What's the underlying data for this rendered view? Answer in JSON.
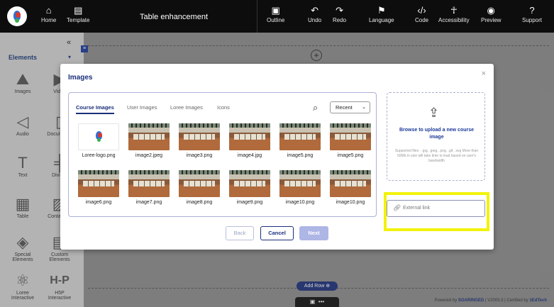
{
  "topbar": {
    "home_label": "Home",
    "template_label": "Template",
    "title": "Table enhancement",
    "outline_label": "Outline",
    "undo_label": "Undo",
    "redo_label": "Redo",
    "language_label": "Language",
    "code_label": "Code",
    "accessibility_label": "Accessibility",
    "preview_label": "Preview",
    "support_label": "Support"
  },
  "sidebar": {
    "heading": "Elements",
    "items": [
      {
        "label": "Images",
        "icon": "image-icon"
      },
      {
        "label": "Video",
        "icon": "video-icon"
      },
      {
        "label": "Audio",
        "icon": "speaker-icon"
      },
      {
        "label": "Documents",
        "icon": "document-icon"
      },
      {
        "label": "Text",
        "icon": "text-icon"
      },
      {
        "label": "Divider",
        "icon": "divider-icon"
      },
      {
        "label": "Table",
        "icon": "table-icon"
      },
      {
        "label": "Containers",
        "icon": "container-icon"
      },
      {
        "label": "Special Elements",
        "icon": "special-elements-icon"
      },
      {
        "label": "Custom Elements",
        "icon": "custom-elements-icon"
      },
      {
        "label": "Loree Interactive",
        "icon": "interactive-icon"
      },
      {
        "label": "H5P Interactive",
        "icon": "h5p-icon"
      }
    ]
  },
  "canvas": {
    "add_row_label": "Add Row",
    "footer_powered": "Powered by",
    "footer_brand": "SOARINGED",
    "footer_version": "V2003.3",
    "footer_certified": "Certified by",
    "footer_cert_brand": "1EdTech"
  },
  "modal": {
    "title": "Images",
    "tabs": [
      "Course Images",
      "User Images",
      "Loree Images",
      "Icons"
    ],
    "sort_value": "Recent",
    "images": [
      "Loree-logo.png",
      "image2.jpeg",
      "image3.png",
      "image4.jpg",
      "image5.png",
      "image5.png",
      "image6.png",
      "image7.png",
      "image8.png",
      "image9.png",
      "image10.png",
      "image10.png"
    ],
    "upload_title": "Browse to upload a new course image",
    "upload_hint": "Supported files - .jpg, .jpeg, .png, .gif, .svg More than 50Mb in size will take time to load based on user's bandwidth",
    "external_link_placeholder": "External link",
    "back_label": "Back",
    "cancel_label": "Cancel",
    "next_label": "Next",
    "close_symbol": "×"
  },
  "colors": {
    "brand": "#1b2f7a",
    "highlight": "#f2f20a"
  }
}
